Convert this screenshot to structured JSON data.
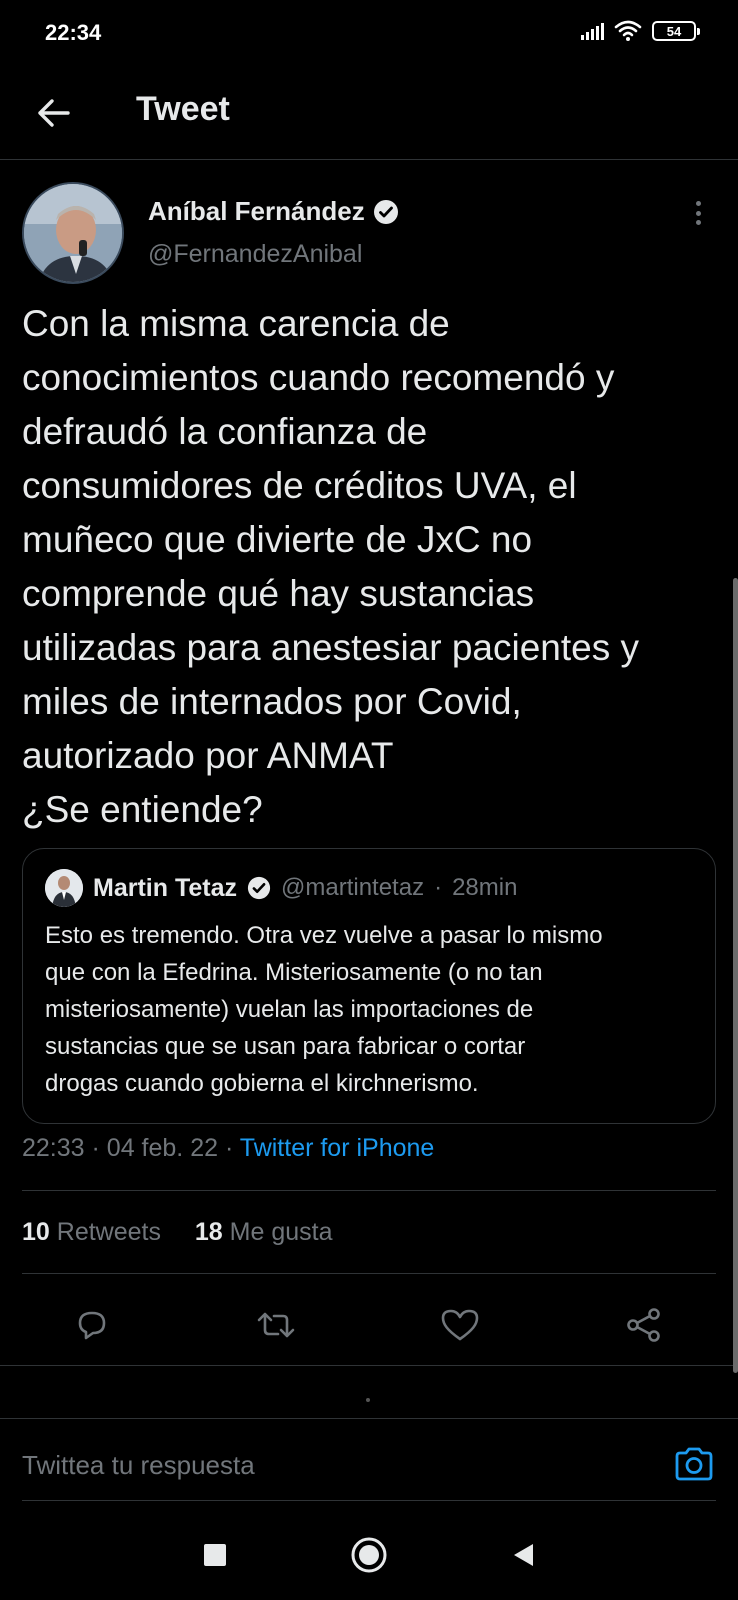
{
  "status_bar": {
    "time": "22:34",
    "battery": "54",
    "icons": [
      "signal-icon",
      "wifi-icon",
      "battery-icon"
    ]
  },
  "header": {
    "title": "Tweet",
    "back_icon": "arrow-left-icon"
  },
  "tweet": {
    "author_name": "Aníbal Fernández",
    "verified": true,
    "author_handle": "@FernandezAnibal",
    "text": "Con la misma carencia de\nconocimientos cuando recomendó y\ndefraudó la confianza de\nconsumidores de créditos UVA, el\nmuñeco que divierte de JxC no\ncomprende qué hay sustancias\nutilizadas para anestesiar pacientes y\nmiles de internados por Covid,\nautorizado por ANMAT\n¿Se entiende?",
    "time": "22:33",
    "date": "04 feb. 22",
    "source": "Twitter for iPhone",
    "retweets_count": "10",
    "retweets_label": "Retweets",
    "likes_count": "18",
    "likes_label": "Me gusta"
  },
  "quoted_tweet": {
    "author_name": "Martin Tetaz",
    "verified": true,
    "author_handle": "@martintetaz",
    "time_ago": "28min",
    "text": "Esto es tremendo. Otra vez vuelve a pasar lo mismo\nque con la Efedrina. Misteriosamente (o no tan\nmisteriosamente) vuelan las importaciones de\nsustancias que se usan para fabricar o cortar\ndrogas cuando gobierna el kirchnerismo."
  },
  "actions": [
    "reply-icon",
    "retweet-icon",
    "like-icon",
    "share-icon"
  ],
  "reply": {
    "placeholder": "Twittea tu respuesta",
    "camera_icon": "camera-icon"
  },
  "colors": {
    "background": "#000000",
    "text": "#e7e9ea",
    "secondary": "#71767b",
    "accent": "#1d9bf0",
    "border": "#2f3336"
  },
  "nav_bar": [
    "recent-apps-icon",
    "home-icon",
    "back-triangle-icon"
  ]
}
